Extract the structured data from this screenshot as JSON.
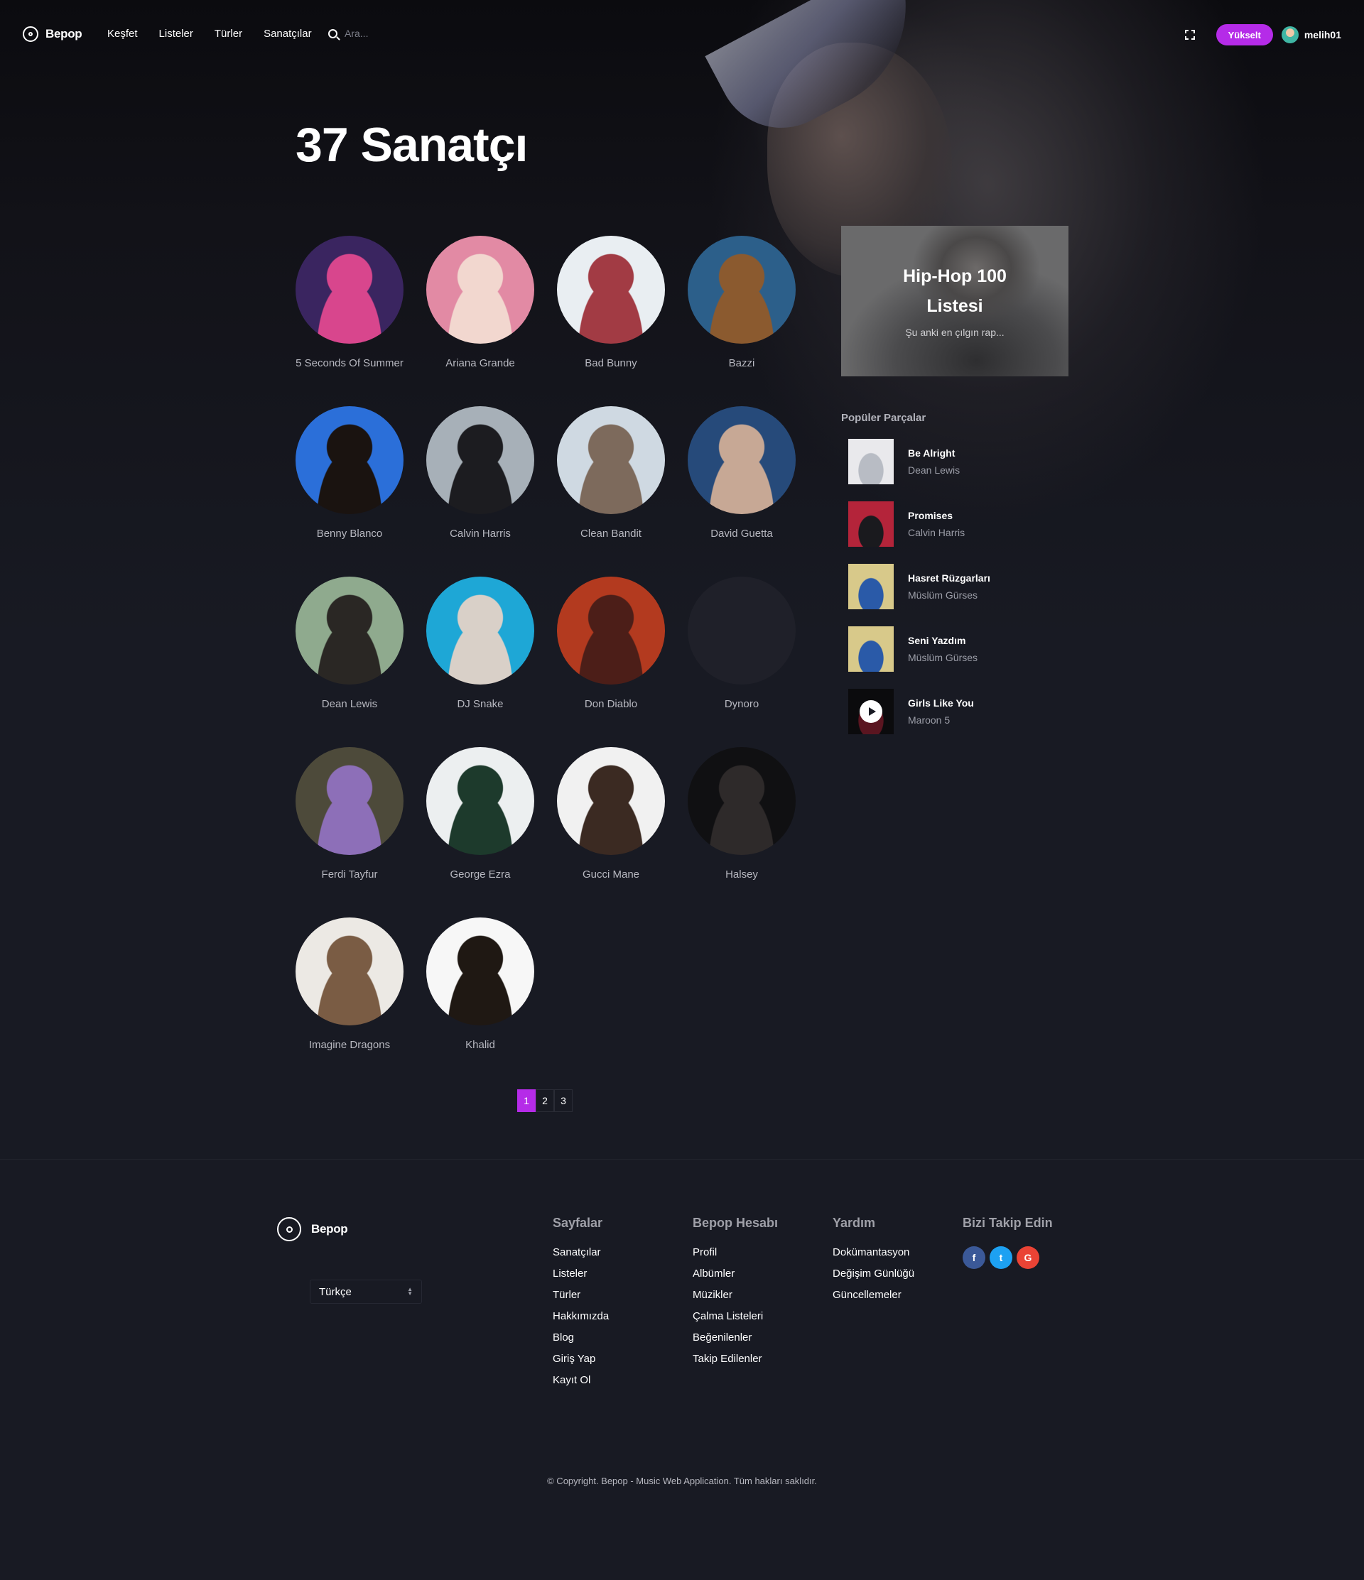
{
  "nav": {
    "brand": "Bepop",
    "links": [
      "Keşfet",
      "Listeler",
      "Türler",
      "Sanatçılar"
    ],
    "search_placeholder": "Ara...",
    "upgrade_label": "Yükselt",
    "username": "melih01"
  },
  "page": {
    "title": "37 Sanatçı"
  },
  "artists": [
    {
      "name": "5 Seconds Of Summer",
      "colors": [
        "#3a2560",
        "#d8468d"
      ]
    },
    {
      "name": "Ariana Grande",
      "colors": [
        "#e28aa4",
        "#f2d7cf"
      ]
    },
    {
      "name": "Bad Bunny",
      "colors": [
        "#e9eef2",
        "#a23b44"
      ]
    },
    {
      "name": "Bazzi",
      "colors": [
        "#2c5f8a",
        "#8b5a2f"
      ]
    },
    {
      "name": "Benny Blanco",
      "colors": [
        "#2b6fd9",
        "#1a1310"
      ]
    },
    {
      "name": "Calvin Harris",
      "colors": [
        "#a7b0b8",
        "#1c1c20"
      ]
    },
    {
      "name": "Clean Bandit",
      "colors": [
        "#cfd9e2",
        "#7d6a5c"
      ]
    },
    {
      "name": "David Guetta",
      "colors": [
        "#264a7a",
        "#c7a895"
      ]
    },
    {
      "name": "Dean Lewis",
      "colors": [
        "#8faa8e",
        "#2a2724"
      ]
    },
    {
      "name": "DJ Snake",
      "colors": [
        "#1ea7d6",
        "#d9d0c8"
      ]
    },
    {
      "name": "Don Diablo",
      "colors": [
        "#b33a1f",
        "#4c1e18"
      ]
    },
    {
      "name": "Dynoro",
      "colors": [
        "#1f2029",
        "#1f2029"
      ]
    },
    {
      "name": "Ferdi Tayfur",
      "colors": [
        "#4d4a3a",
        "#8d6fb8"
      ]
    },
    {
      "name": "George Ezra",
      "colors": [
        "#eceff0",
        "#1d3a2c"
      ]
    },
    {
      "name": "Gucci Mane",
      "colors": [
        "#f1f1f1",
        "#3b2a22"
      ]
    },
    {
      "name": "Halsey",
      "colors": [
        "#101012",
        "#2e2a2a"
      ]
    },
    {
      "name": "Imagine Dragons",
      "colors": [
        "#ece9e4",
        "#7a5c44"
      ]
    },
    {
      "name": "Khalid",
      "colors": [
        "#f7f7f7",
        "#1f1813"
      ]
    }
  ],
  "promo": {
    "title": "Hip-Hop 100 Listesi",
    "subtitle": "Şu anki en çılgın rap..."
  },
  "popular": {
    "heading": "Popüler Parçalar",
    "tracks": [
      {
        "title": "Be Alright",
        "artist": "Dean Lewis",
        "colors": [
          "#e9e9ec",
          "#b8bcc4"
        ]
      },
      {
        "title": "Promises",
        "artist": "Calvin Harris",
        "colors": [
          "#b4243a",
          "#1a1a1e"
        ]
      },
      {
        "title": "Hasret Rüzgarları",
        "artist": "Müslüm Gürses",
        "colors": [
          "#d8c98a",
          "#2a5aa8"
        ]
      },
      {
        "title": "Seni Yazdım",
        "artist": "Müslüm Gürses",
        "colors": [
          "#d8c98a",
          "#2a5aa8"
        ]
      },
      {
        "title": "Girls Like You",
        "artist": "Maroon 5",
        "colors": [
          "#0b0b0d",
          "#5a1520"
        ]
      }
    ]
  },
  "pagination": {
    "pages": [
      "1",
      "2",
      "3"
    ],
    "active": "1"
  },
  "footer": {
    "brand": "Bepop",
    "language": "Türkçe",
    "columns": [
      {
        "heading": "Sayfalar",
        "links": [
          "Sanatçılar",
          "Listeler",
          "Türler",
          "Hakkımızda",
          "Blog",
          "Giriş Yap",
          "Kayıt Ol"
        ]
      },
      {
        "heading": "Bepop Hesabı",
        "links": [
          "Profil",
          "Albümler",
          "Müzikler",
          "Çalma Listeleri",
          "Beğenilenler",
          "Takip Edilenler"
        ]
      },
      {
        "heading": "Yardım",
        "links": [
          "Dokümantasyon",
          "Değişim Günlüğü",
          "Güncellemeler"
        ]
      }
    ],
    "social_heading": "Bizi Takip Edin",
    "social": [
      {
        "icon": "facebook-icon",
        "glyph": "f",
        "color": "#3b5998"
      },
      {
        "icon": "twitter-icon",
        "glyph": "t",
        "color": "#1da1f2"
      },
      {
        "icon": "google-icon",
        "glyph": "G",
        "color": "#ea4335"
      }
    ],
    "copyright": "© Copyright. Bepop - Music Web Application. Tüm hakları saklıdır."
  },
  "colors": {
    "accent": "#b52be8",
    "background": "#181a23"
  }
}
